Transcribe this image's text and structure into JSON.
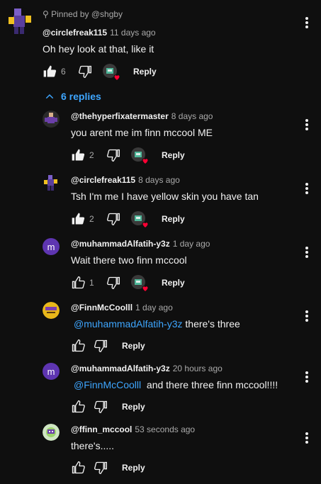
{
  "top_comment": {
    "pinned_label": "Pinned by @shgby",
    "author": "@circlefreak115",
    "time": "11 days ago",
    "text": "Oh hey look at that, like it",
    "likes": "6",
    "reply_label": "Reply"
  },
  "replies_toggle": {
    "label": "6 replies"
  },
  "replies": [
    {
      "author": "@thehyperfixatermaster",
      "time": "8 days ago",
      "text": "you arent me im finn mccool ME",
      "likes": "2",
      "reply_label": "Reply",
      "avatar_letter": "",
      "avatar_color": "#2a2a2a",
      "hearted": true,
      "mention": "",
      "text_after_mention": ""
    },
    {
      "author": "@circlefreak115",
      "time": "8 days ago",
      "text": "Tsh I'm me I have yellow skin you have tan",
      "likes": "2",
      "reply_label": "Reply",
      "avatar_letter": "",
      "avatar_color": "#0f0f0f",
      "hearted": true,
      "mention": "",
      "text_after_mention": ""
    },
    {
      "author": "@muhammadAlfatih-y3z",
      "time": "1 day ago",
      "text": "Wait there two finn mccool",
      "likes": "1",
      "reply_label": "Reply",
      "avatar_letter": "m",
      "avatar_color": "#5e35b1",
      "hearted": true,
      "mention": "",
      "text_after_mention": ""
    },
    {
      "author": "@FinnMcCoolll",
      "time": "1 day ago",
      "text": "",
      "likes": "",
      "reply_label": "Reply",
      "avatar_letter": "",
      "avatar_color": "#e8b71a",
      "hearted": false,
      "mention": "@muhammadAlfatih-y3z",
      "text_after_mention": " there's three"
    },
    {
      "author": "@muhammadAlfatih-y3z",
      "time": "20 hours ago",
      "text": "",
      "likes": "",
      "reply_label": "Reply",
      "avatar_letter": "m",
      "avatar_color": "#5e35b1",
      "hearted": false,
      "mention": "@FinnMcCoolll",
      "text_after_mention": "  and there three finn mccool!!!!"
    },
    {
      "author": "@ffinn_mccool",
      "time": "53 seconds ago",
      "text": "there's.....",
      "likes": "",
      "reply_label": "Reply",
      "avatar_letter": "",
      "avatar_color": "#9bd36b",
      "hearted": false,
      "mention": "",
      "text_after_mention": ""
    }
  ],
  "colors": {
    "background": "#0f0f0f",
    "link": "#3ea6ff",
    "heart": "#ff0033",
    "muted": "#aaaaaa"
  }
}
